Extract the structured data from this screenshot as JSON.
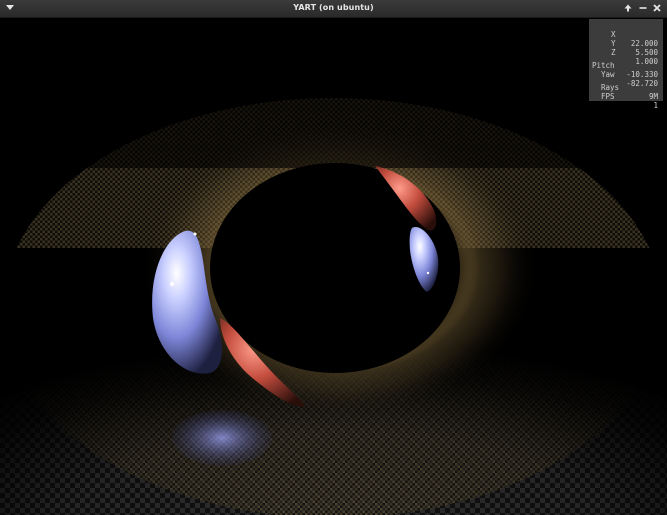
{
  "window": {
    "title": "YART (on ubuntu)",
    "menu_icon": "chevron-down-icon",
    "buttons": [
      "maximize-icon",
      "minimize-icon",
      "close-icon"
    ]
  },
  "stats": {
    "x": {
      "label": "X",
      "value": "22.000"
    },
    "y": {
      "label": "Y",
      "value": "5.500"
    },
    "z": {
      "label": "Z",
      "value": "1.000"
    },
    "pitch": {
      "label": "Pitch",
      "value": "-10.330"
    },
    "yaw": {
      "label": "Yaw",
      "value": "-82.720"
    },
    "rays": {
      "label": "Rays",
      "value": "9M"
    },
    "fps": {
      "label": "FPS",
      "value": "1"
    }
  },
  "colors": {
    "titlebar": "#2f2f2f",
    "title_text": "#e6e6e6",
    "stats_bg": "#464646",
    "sphere_blue": "#9aa6ff",
    "sphere_red": "#d25a4a",
    "floor_warm": "#c9a25a"
  }
}
